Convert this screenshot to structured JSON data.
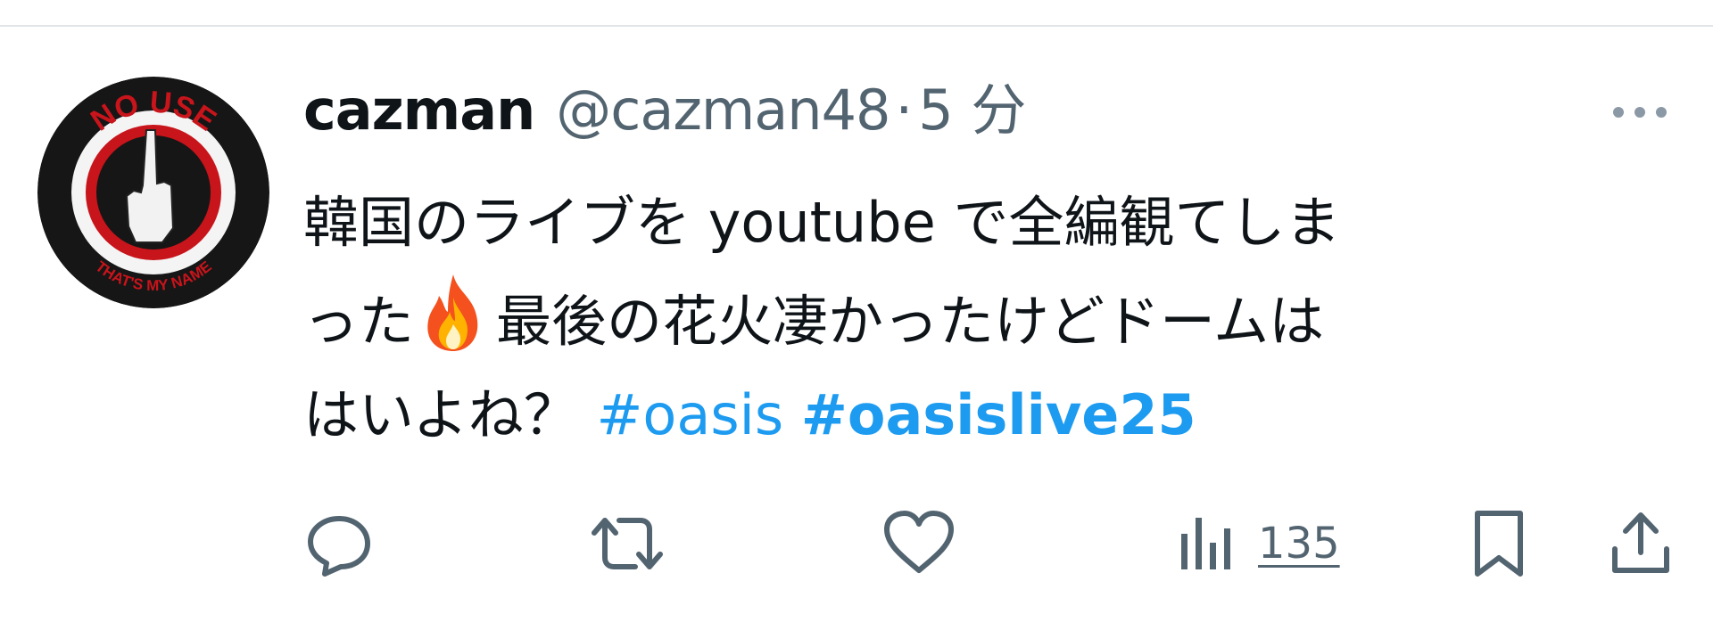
{
  "tweet": {
    "display_name": "cazman",
    "handle": "@cazman48",
    "separator": "·",
    "timestamp": "5 分",
    "text_line1": "韓国のライブを youtube で全編観てしま",
    "text_line2_before_emoji": "った",
    "text_line2_after_emoji": "最後の花火凄かったけどドームは",
    "text_line3": "はいよね？",
    "hashtags": [
      "#oasis",
      "#oasislive25"
    ],
    "emoji": "fire-emoji"
  },
  "avatar": {
    "top_text": "NO USE",
    "bottom_text": "THAT'S MY NAME"
  },
  "actions": {
    "views_count": "135"
  },
  "icons": {
    "reply": "reply-icon",
    "retweet": "retweet-icon",
    "like": "heart-icon",
    "views": "bar-chart-icon",
    "bookmark": "bookmark-icon",
    "share": "share-icon",
    "more": "more-icon"
  },
  "colors": {
    "text": "#0f1419",
    "secondary": "#536471",
    "link": "#1d9bf0",
    "divider": "#e1e5e8"
  }
}
